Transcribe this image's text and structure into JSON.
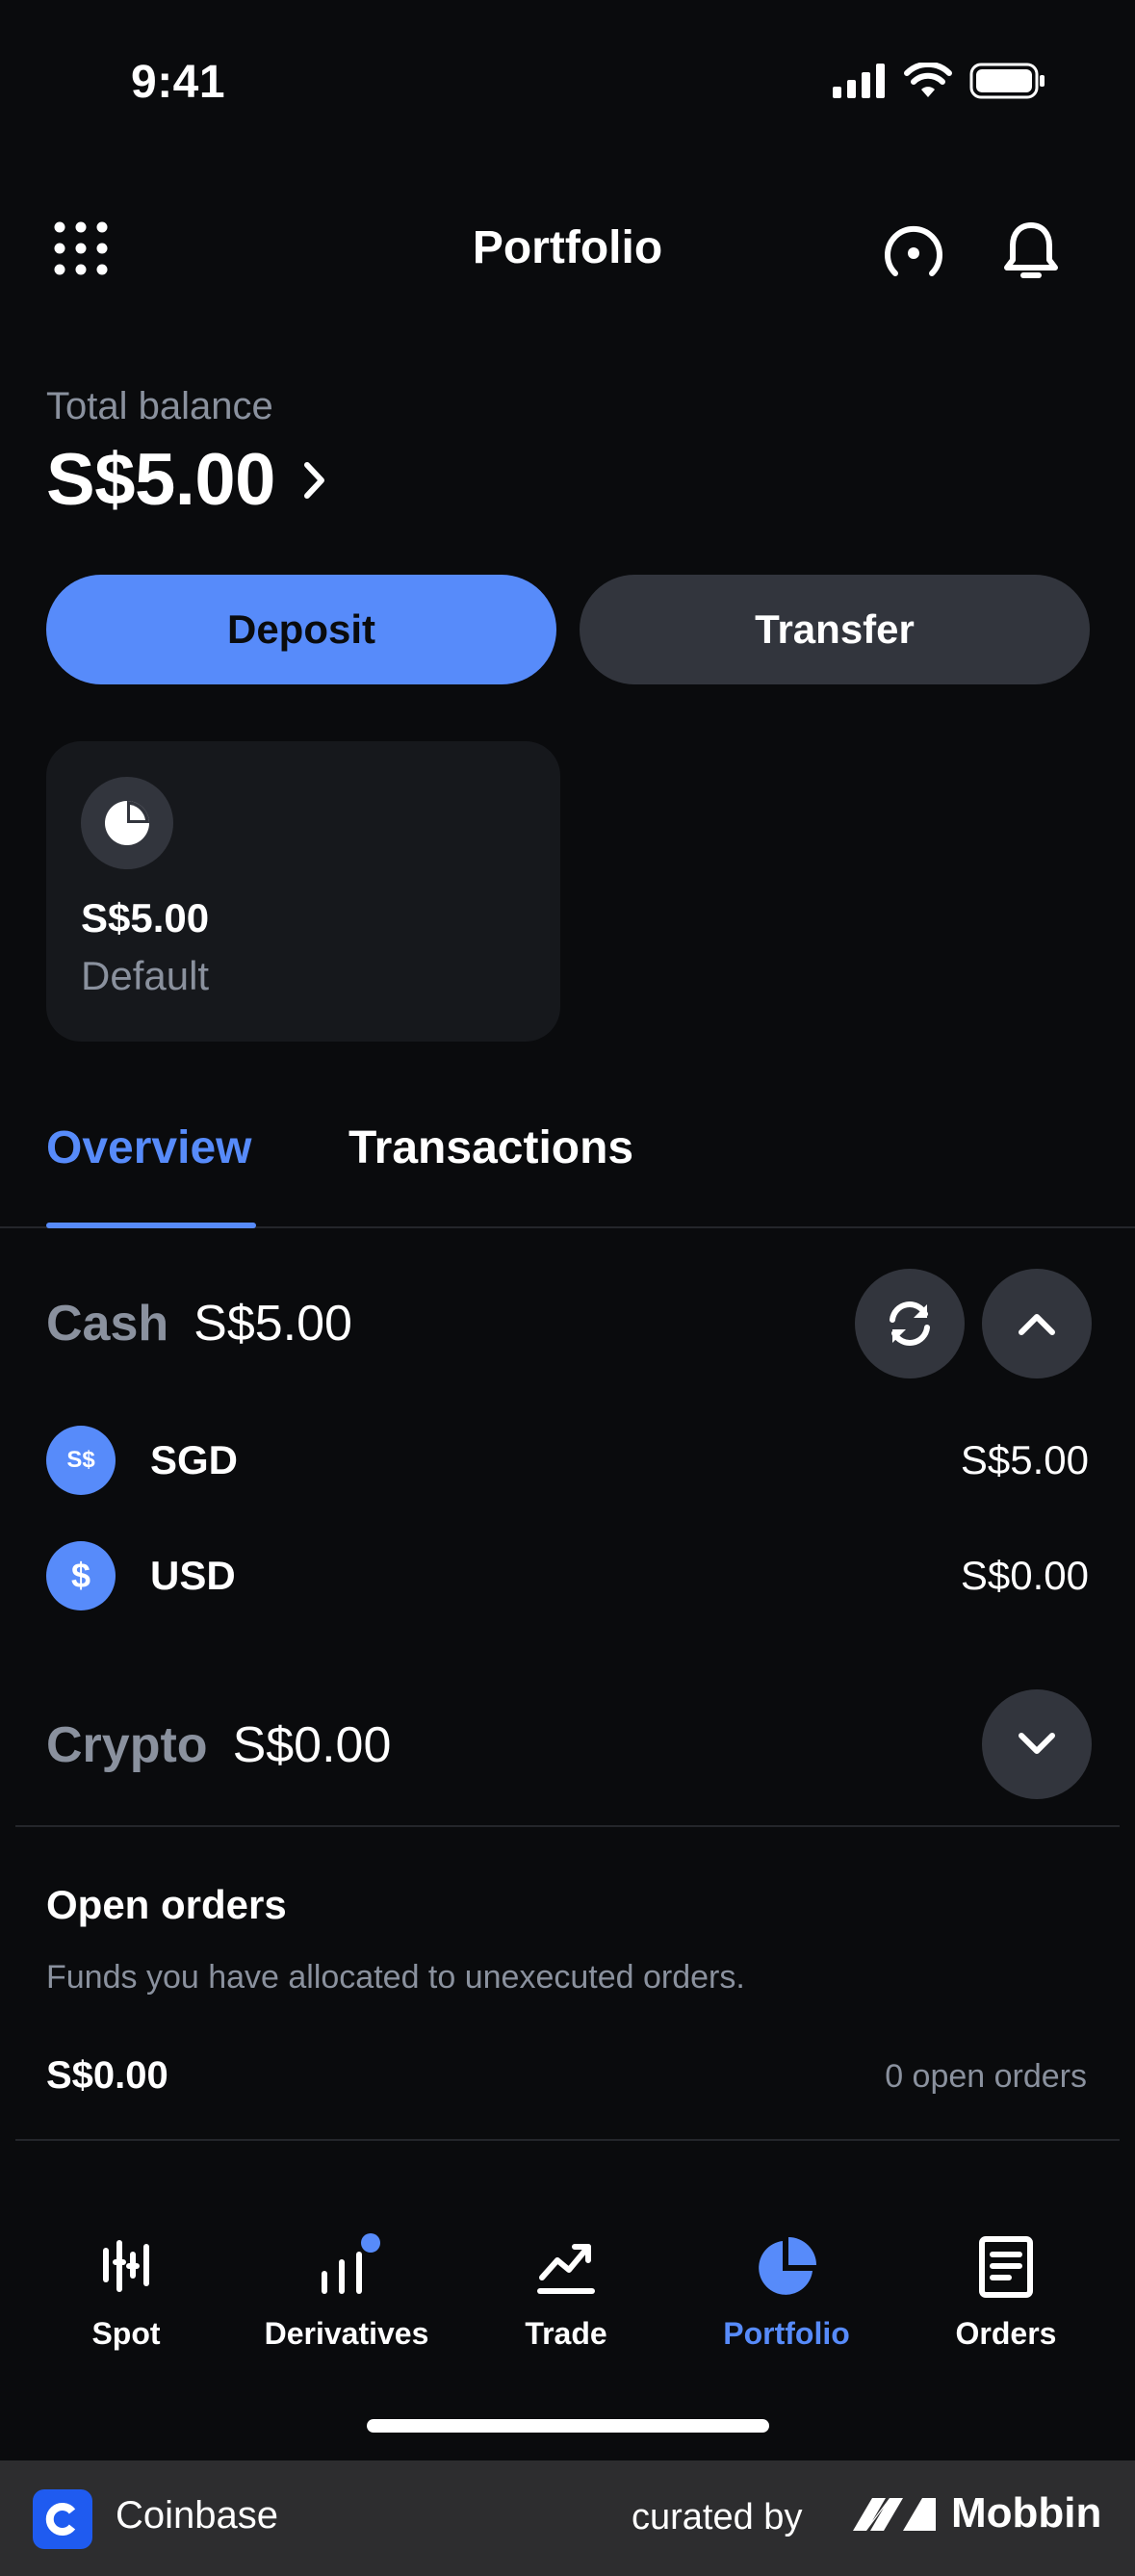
{
  "status_bar": {
    "time": "9:41"
  },
  "header": {
    "title": "Portfolio"
  },
  "balance": {
    "label": "Total balance",
    "value": "S$5.00"
  },
  "actions": {
    "deposit_label": "Deposit",
    "transfer_label": "Transfer"
  },
  "portfolio_card": {
    "amount": "S$5.00",
    "name": "Default"
  },
  "tabs": [
    {
      "label": "Overview",
      "active": true
    },
    {
      "label": "Transactions",
      "active": false
    }
  ],
  "cash": {
    "label": "Cash",
    "total": "S$5.00",
    "assets": [
      {
        "badge": "S$",
        "code": "SGD",
        "value": "S$5.00"
      },
      {
        "badge": "$",
        "code": "USD",
        "value": "S$0.00"
      }
    ]
  },
  "crypto": {
    "label": "Crypto",
    "total": "S$0.00"
  },
  "open_orders": {
    "title": "Open orders",
    "description": "Funds you have allocated to unexecuted orders.",
    "amount": "S$0.00",
    "count": "0 open orders"
  },
  "bottom_nav": [
    {
      "label": "Spot",
      "icon": "spot-chart-icon",
      "active": false
    },
    {
      "label": "Derivatives",
      "icon": "derivatives-bars-icon",
      "active": false,
      "badge_dot": true
    },
    {
      "label": "Trade",
      "icon": "trade-trend-icon",
      "active": false
    },
    {
      "label": "Portfolio",
      "icon": "portfolio-pie-icon",
      "active": true
    },
    {
      "label": "Orders",
      "icon": "orders-document-icon",
      "active": false
    }
  ],
  "attribution": {
    "app_name": "Coinbase",
    "curated_by": "curated by",
    "brand": "Mobbin"
  },
  "colors": {
    "accent": "#578bfa",
    "background": "#0a0b0d",
    "surface": "#32353d",
    "muted_text": "#8a919e"
  }
}
